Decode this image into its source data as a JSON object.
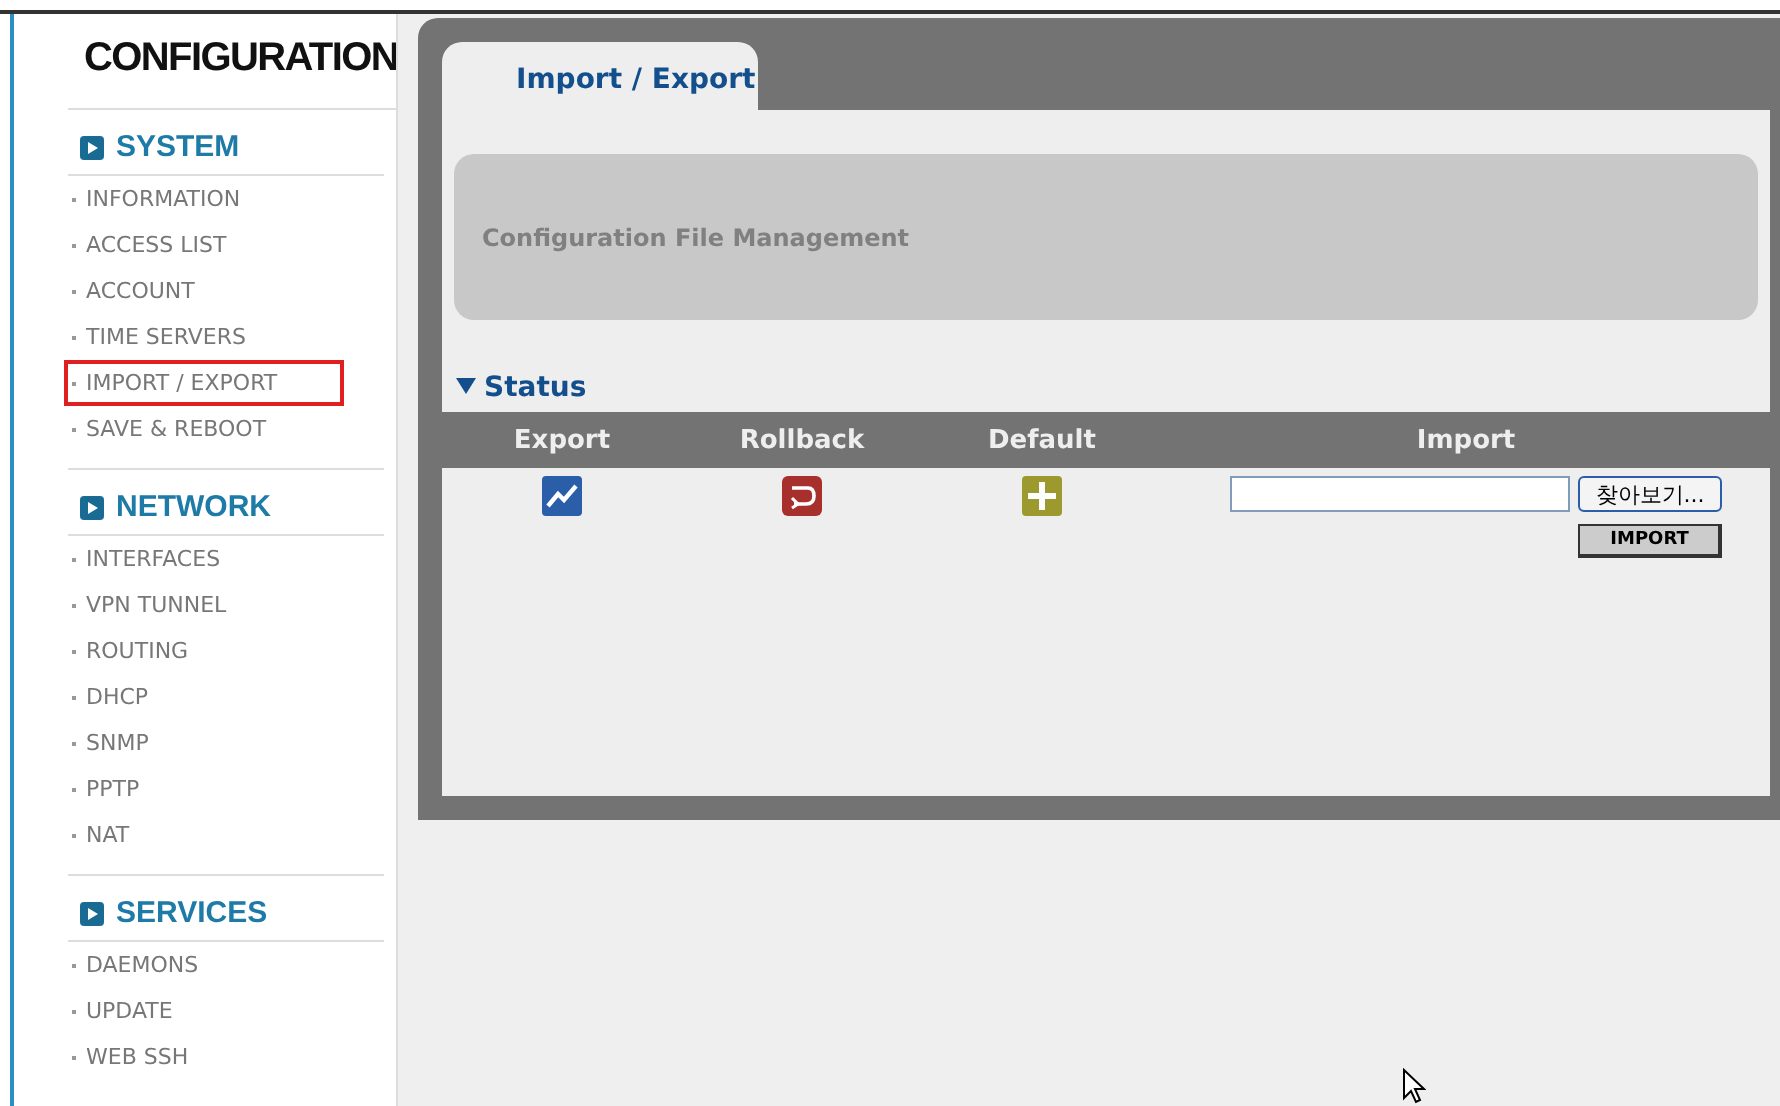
{
  "sidebar": {
    "title": "CONFIGURATION",
    "sections": [
      {
        "title": "SYSTEM",
        "items": [
          {
            "label": "INFORMATION",
            "highlighted": false
          },
          {
            "label": "ACCESS LIST",
            "highlighted": false
          },
          {
            "label": "ACCOUNT",
            "highlighted": false
          },
          {
            "label": "TIME SERVERS",
            "highlighted": false
          },
          {
            "label": "IMPORT / EXPORT",
            "highlighted": true
          },
          {
            "label": "SAVE & REBOOT",
            "highlighted": false
          }
        ]
      },
      {
        "title": "NETWORK",
        "items": [
          {
            "label": "INTERFACES",
            "highlighted": false
          },
          {
            "label": "VPN TUNNEL",
            "highlighted": false
          },
          {
            "label": "ROUTING",
            "highlighted": false
          },
          {
            "label": "DHCP",
            "highlighted": false
          },
          {
            "label": "SNMP",
            "highlighted": false
          },
          {
            "label": "PPTP",
            "highlighted": false
          },
          {
            "label": "NAT",
            "highlighted": false
          }
        ]
      },
      {
        "title": "SERVICES",
        "items": [
          {
            "label": "DAEMONS",
            "highlighted": false
          },
          {
            "label": "UPDATE",
            "highlighted": false
          },
          {
            "label": "WEB SSH",
            "highlighted": false
          }
        ]
      }
    ]
  },
  "tabs": [
    {
      "label": "Import / Export",
      "selected": true
    }
  ],
  "banner": "Configuration File Management",
  "status": {
    "title": "Status",
    "expanded": true,
    "columns": [
      {
        "heading": "Export",
        "kind": "export"
      },
      {
        "heading": "Rollback",
        "kind": "rollback"
      },
      {
        "heading": "Default",
        "kind": "default"
      },
      {
        "heading": "Import",
        "kind": "import"
      }
    ],
    "browse_button": "찾아보기...",
    "import_button": "IMPORT"
  }
}
